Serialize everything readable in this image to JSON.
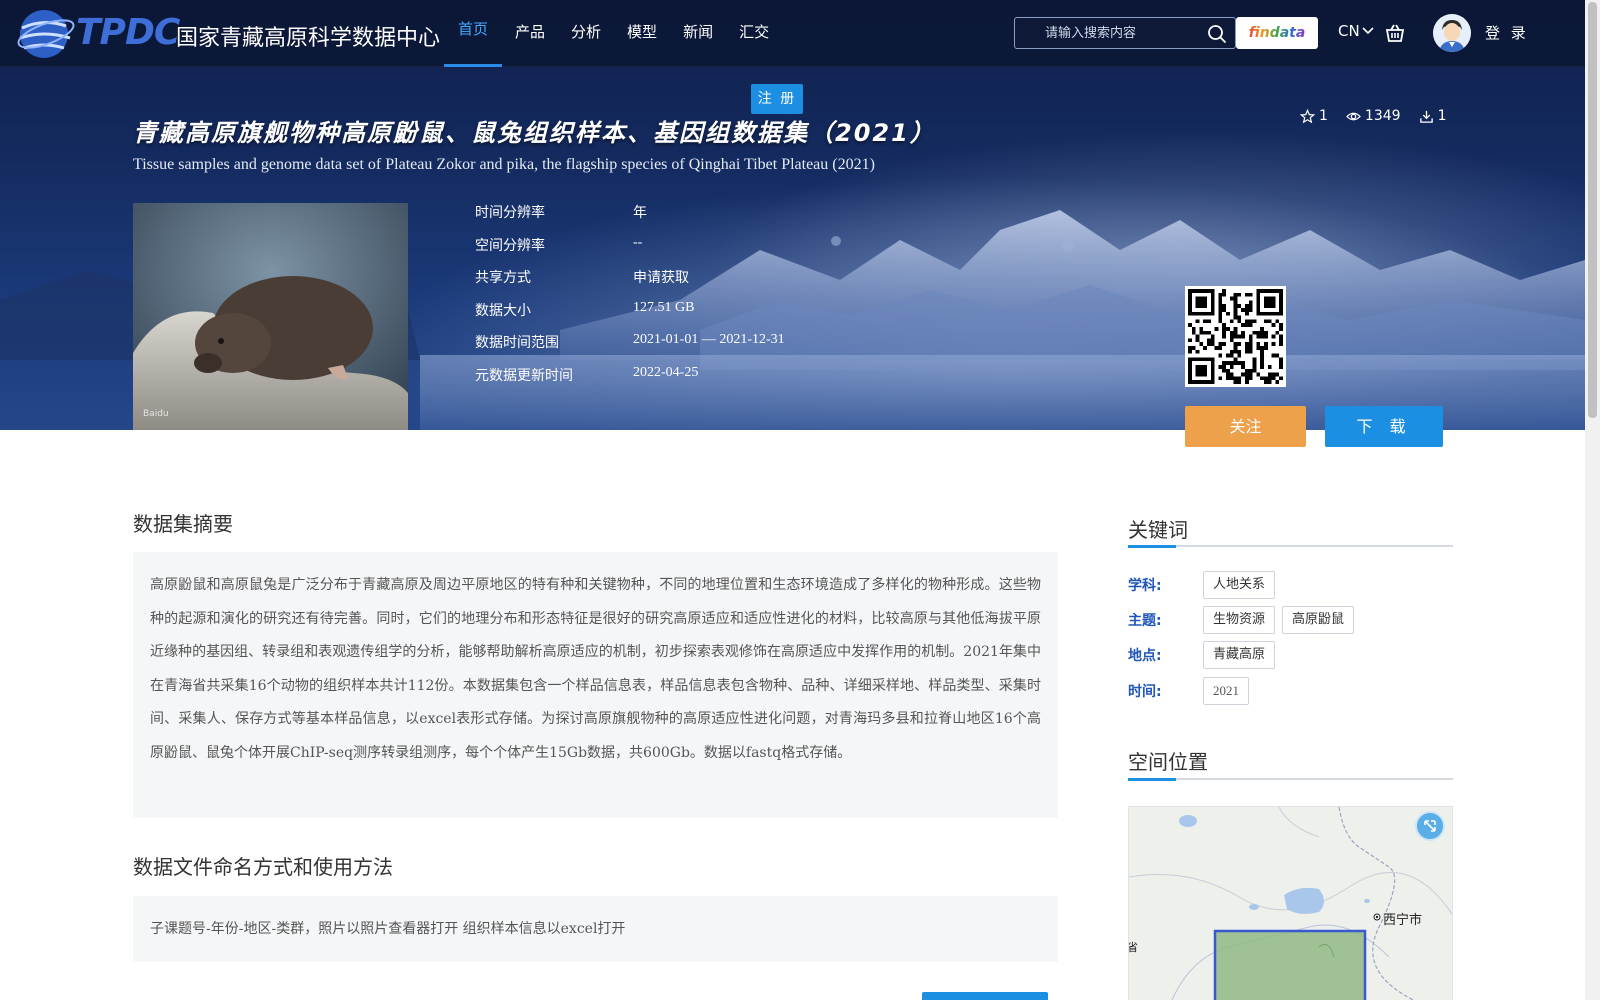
{
  "brand": {
    "abbr": "TPDC",
    "name": "国家青藏高原科学数据中心"
  },
  "nav": {
    "items": [
      {
        "label": "首页",
        "active": true
      },
      {
        "label": "产品"
      },
      {
        "label": "分析"
      },
      {
        "label": "模型"
      },
      {
        "label": "新闻"
      },
      {
        "label": "汇交"
      }
    ]
  },
  "search": {
    "placeholder": "请输入搜索内容",
    "icon": "search-icon"
  },
  "header": {
    "findata_label": "findata",
    "lang": "CN",
    "cart_icon": "cart-icon",
    "login_label": "登 录",
    "register_label": "注 册"
  },
  "dataset": {
    "title_cn": "青藏高原旗舰物种高原鼢鼠、鼠兔组织样本、基因组数据集（2021）",
    "title_en": "Tissue samples and genome data set of Plateau Zokor and pika, the flagship species of Qinghai Tibet Plateau (2021)",
    "stats": {
      "stars": "1",
      "views": "1349",
      "downloads": "1"
    },
    "thumbnail_watermark": "Baidu",
    "meta": [
      {
        "label": "时间分辨率",
        "value": "年"
      },
      {
        "label": "空间分辨率",
        "value": "--"
      },
      {
        "label": "共享方式",
        "value": "申请获取"
      },
      {
        "label": "数据大小",
        "value": "127.51 GB"
      },
      {
        "label": "数据时间范围",
        "value": "2021-01-01 — 2021-12-31"
      },
      {
        "label": "元数据更新时间",
        "value": "2022-04-25"
      }
    ],
    "follow_label": "关注",
    "download_label": "下 载"
  },
  "abstract": {
    "title": "数据集摘要",
    "text": "高原鼢鼠和高原鼠兔是广泛分布于青藏高原及周边平原地区的特有种和关键物种，不同的地理位置和生态环境造成了多样化的物种形成。这些物种的起源和演化的研究还有待完善。同时，它们的地理分布和形态特征是很好的研究高原适应和适应性进化的材料，比较高原与其他低海拔平原近缘种的基因组、转录组和表观遗传组学的分析，能够帮助解析高原适应的机制，初步探索表观修饰在高原适应中发挥作用的机制。2021年集中在青海省共采集16个动物的组织样本共计112份。本数据集包含一个样品信息表，样品信息表包含物种、品种、详细采样地、样品类型、采集时间、采集人、保存方式等基本样品信息，以excel表形式存储。为探讨高原旗舰物种的高原适应性进化问题，对青海玛多县和拉脊山地区16个高原鼢鼠、鼠兔个体开展ChIP-seq测序转录组测序，每个个体产生15Gb数据，共600Gb。数据以fastq格式存储。"
  },
  "file_naming": {
    "title": "数据文件命名方式和使用方法",
    "text": "子课题号-年份-地区-类群，照片以照片查看器打开 组织样本信息以excel打开"
  },
  "keywords": {
    "title": "关键词",
    "rows": [
      {
        "label": "学科:",
        "tags": [
          "人地关系"
        ]
      },
      {
        "label": "主题:",
        "tags": [
          "生物资源",
          "高原鼢鼠"
        ]
      },
      {
        "label": "地点:",
        "tags": [
          "青藏高原"
        ]
      },
      {
        "label": "时间:",
        "tags": [
          "2021"
        ]
      }
    ]
  },
  "location": {
    "title": "空间位置",
    "city_label": "西宁市",
    "edge_label": "省",
    "fullscreen_icon": "expand-icon"
  },
  "colors": {
    "accent": "#1d8fe2",
    "follow": "#eda14a",
    "keyword_label": "#1f56b7"
  }
}
